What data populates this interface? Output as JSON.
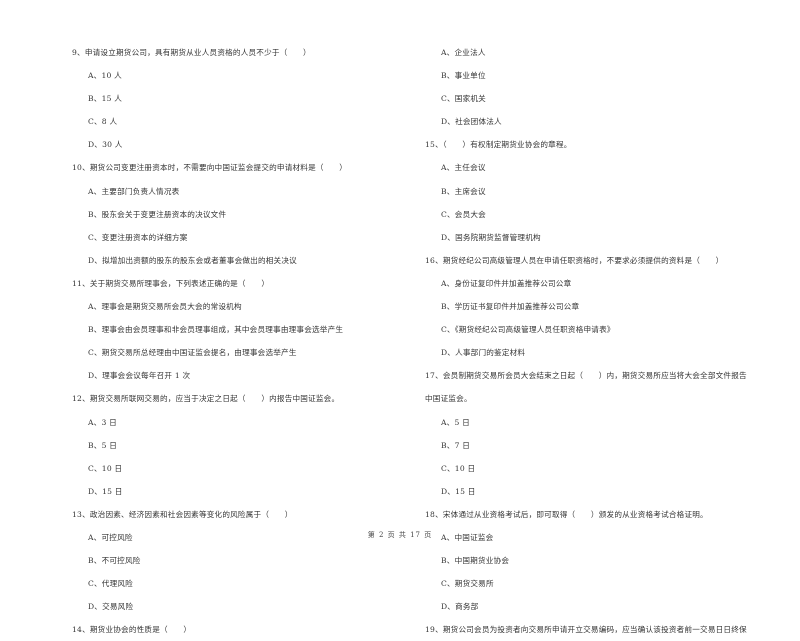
{
  "left_column": [
    {
      "type": "question",
      "text": "9、申请设立期货公司，具有期货从业人员资格的人员不少于（　　）"
    },
    {
      "type": "option",
      "text": "A、10 人"
    },
    {
      "type": "option",
      "text": "B、15 人"
    },
    {
      "type": "option",
      "text": "C、8 人"
    },
    {
      "type": "option",
      "text": "D、30 人"
    },
    {
      "type": "question",
      "text": "10、期货公司变更注册资本时，不需要向中国证监会提交的申请材料是（　　）"
    },
    {
      "type": "option",
      "text": "A、主要部门负责人情况表"
    },
    {
      "type": "option",
      "text": "B、股东会关于变更注册资本的决议文件"
    },
    {
      "type": "option",
      "text": "C、变更注册资本的详细方案"
    },
    {
      "type": "option",
      "text": "D、拟增加出资额的股东的股东会或者董事会做出的相关决议"
    },
    {
      "type": "question",
      "text": "11、关于期货交易所理事会，下列表述正确的是（　　）"
    },
    {
      "type": "option",
      "text": "A、理事会是期货交易所会员大会的常设机构"
    },
    {
      "type": "option",
      "text": "B、理事会由会员理事和非会员理事组成，其中会员理事由理事会选举产生"
    },
    {
      "type": "option",
      "text": "C、期货交易所总经理由中国证监会提名，由理事会选举产生"
    },
    {
      "type": "option",
      "text": "D、理事会会议每年召开 1 次"
    },
    {
      "type": "question",
      "text": "12、期货交易所联网交易的，应当于决定之日起（　　）内报告中国证监会。"
    },
    {
      "type": "option",
      "text": "A、3 日"
    },
    {
      "type": "option",
      "text": "B、5 日"
    },
    {
      "type": "option",
      "text": "C、10 日"
    },
    {
      "type": "option",
      "text": "D、15 日"
    },
    {
      "type": "question",
      "text": "13、政治因素、经济因素和社会因素等变化的风险属于（　　）"
    },
    {
      "type": "option",
      "text": "A、可控风险"
    },
    {
      "type": "option",
      "text": "B、不可控风险"
    },
    {
      "type": "option",
      "text": "C、代理风险"
    },
    {
      "type": "option",
      "text": "D、交易风险"
    },
    {
      "type": "question",
      "text": "14、期货业协会的性质是（　　）"
    }
  ],
  "right_column": [
    {
      "type": "option",
      "text": "A、企业法人"
    },
    {
      "type": "option",
      "text": "B、事业单位"
    },
    {
      "type": "option",
      "text": "C、国家机关"
    },
    {
      "type": "option",
      "text": "D、社会团体法人"
    },
    {
      "type": "question",
      "text": "15、（　　）有权制定期货业协会的章程。"
    },
    {
      "type": "option",
      "text": "A、主任会议"
    },
    {
      "type": "option",
      "text": "B、主席会议"
    },
    {
      "type": "option",
      "text": "C、会员大会"
    },
    {
      "type": "option",
      "text": "D、国务院期货监督管理机构"
    },
    {
      "type": "question",
      "text": "16、期货经纪公司高级管理人员在申请任职资格时，不要求必须提供的资料是（　　）"
    },
    {
      "type": "option",
      "text": "A、身份证复印件并加盖推荐公司公章"
    },
    {
      "type": "option",
      "text": "B、学历证书复印件并加盖推荐公司公章"
    },
    {
      "type": "option",
      "text": "C、《期货经纪公司高级管理人员任职资格申请表》"
    },
    {
      "type": "option",
      "text": "D、人事部门的鉴定材料"
    },
    {
      "type": "question",
      "text": "17、会员制期货交易所会员大会结束之日起（　　）内，期货交易所应当将大会全部文件报告"
    },
    {
      "type": "question",
      "text": "中国证监会。"
    },
    {
      "type": "option",
      "text": "A、5 日"
    },
    {
      "type": "option",
      "text": "B、7 日"
    },
    {
      "type": "option",
      "text": "C、10 日"
    },
    {
      "type": "option",
      "text": "D、15 日"
    },
    {
      "type": "question",
      "text": "18、宋体通过从业资格考试后，即可取得（　　）颁发的从业资格考试合格证明。"
    },
    {
      "type": "option",
      "text": "A、中国证监会"
    },
    {
      "type": "option",
      "text": "B、中国期货业协会"
    },
    {
      "type": "option",
      "text": "C、期货交易所"
    },
    {
      "type": "option",
      "text": "D、商务部"
    },
    {
      "type": "question",
      "text": "19、期货公司会员为投资者向交易所申请开立交易编码，应当确认该投资者前一交易日日终保"
    }
  ],
  "footer": {
    "page_label": "第 2 页 共 17 页"
  }
}
